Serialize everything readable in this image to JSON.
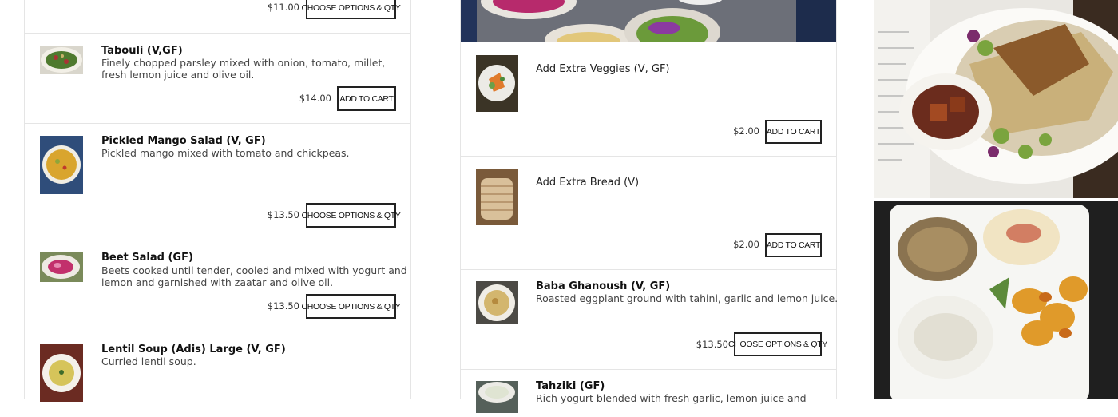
{
  "colors": {
    "border": "#e5e5e5",
    "button_border": "#222222",
    "text": "#333333"
  },
  "left_column": {
    "top_row": {
      "price": "$11.00",
      "button": "CHOOSE OPTIONS & QTY"
    },
    "items": [
      {
        "title": "Tabouli (V,GF)",
        "desc_line1": "Finely chopped parsley mixed with onion, tomato, millet,",
        "desc_line2": "fresh lemon juice and olive oil.",
        "price": "$14.00",
        "button": "ADD TO CART",
        "icon": "tabouli-thumbnail"
      },
      {
        "title": "Pickled Mango Salad (V, GF)",
        "desc_line1": "Pickled mango mixed with tomato and chickpeas.",
        "desc_line2": "",
        "price": "$13.50",
        "button": "CHOOSE OPTIONS & QTY",
        "icon": "mango-salad-thumbnail"
      },
      {
        "title": "Beet Salad (GF)",
        "desc_line1": "Beets cooked until tender, cooled and mixed with yogurt and",
        "desc_line2": "lemon and garnished with zaatar and olive oil.",
        "price": "$13.50",
        "button": "CHOOSE OPTIONS & QTY",
        "icon": "beet-salad-thumbnail"
      },
      {
        "title": "Lentil Soup (Adis) Large (V, GF)",
        "desc_line1": "Curried lentil soup.",
        "desc_line2": "",
        "icon": "lentil-soup-thumbnail"
      }
    ]
  },
  "middle_column": {
    "items": [
      {
        "title": "Add Extra Veggies (V, GF)",
        "price": "$2.00",
        "button": "ADD TO CART",
        "icon": "veggies-thumbnail"
      },
      {
        "title": "Add Extra Bread (V)",
        "price": "$2.00",
        "button": "ADD TO CART",
        "icon": "bread-thumbnail"
      },
      {
        "title": "Baba Ghanoush (V, GF)",
        "desc_line1": "Roasted eggplant ground with tahini, garlic and lemon juice.",
        "price": "$13.50",
        "button": "CHOOSE OPTIONS & QTY",
        "icon": "baba-ghanoush-thumbnail"
      },
      {
        "title": "Tahziki (GF)",
        "desc_line1": "Rich yogurt blended with fresh garlic, lemon juice and",
        "icon": "tahziki-thumbnail"
      }
    ]
  },
  "right_photos": [
    {
      "icon": "platter-photo"
    },
    {
      "icon": "dips-sampler-photo"
    }
  ]
}
